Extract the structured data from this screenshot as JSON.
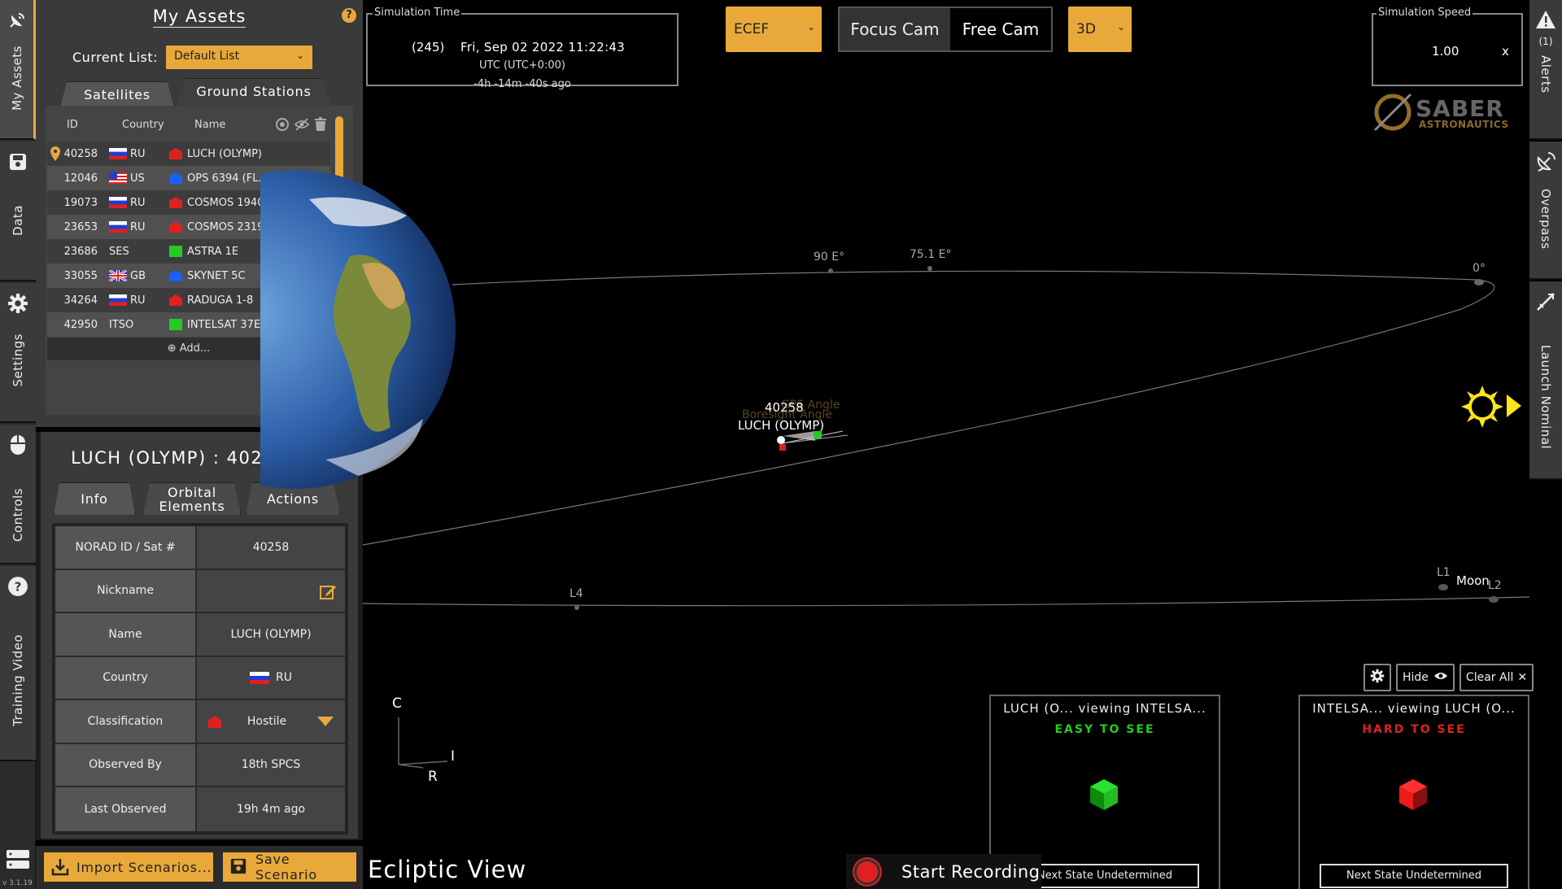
{
  "app": {
    "version": "v 3.1.19"
  },
  "left_rail": {
    "tabs": [
      {
        "label": "My Assets",
        "icon": "satellite-dish-icon"
      },
      {
        "label": "Data",
        "icon": "save-icon"
      },
      {
        "label": "Settings",
        "icon": "gear-icon"
      },
      {
        "label": "Controls",
        "icon": "mouse-icon"
      },
      {
        "label": "Training Video",
        "icon": "help-circle-icon"
      }
    ]
  },
  "assets": {
    "title": "My Assets",
    "current_list_label": "Current List:",
    "current_list_value": "Default List",
    "tabs": [
      "Satellites",
      "Ground Stations"
    ],
    "columns": [
      "ID",
      "Country",
      "Name"
    ],
    "rows": [
      {
        "id": "40258",
        "country": "RU",
        "name": "LUCH (OLYMP)",
        "class": "hostile",
        "flag": "ru"
      },
      {
        "id": "12046",
        "country": "US",
        "name": "OPS 6394 (FL...",
        "class": "friendly",
        "flag": "us"
      },
      {
        "id": "19073",
        "country": "RU",
        "name": "COSMOS 1940",
        "class": "hostile",
        "flag": "ru"
      },
      {
        "id": "23653",
        "country": "RU",
        "name": "COSMOS 2319",
        "class": "hostile",
        "flag": "ru"
      },
      {
        "id": "23686",
        "country": "SES",
        "name": "ASTRA 1E",
        "class": "neutral",
        "flag": ""
      },
      {
        "id": "33055",
        "country": "GB",
        "name": "SKYNET 5C",
        "class": "friendly",
        "flag": "gb"
      },
      {
        "id": "34264",
        "country": "RU",
        "name": "RADUGA 1-8",
        "class": "hostile",
        "flag": "ru"
      },
      {
        "id": "42950",
        "country": "ITSO",
        "name": "INTELSAT 37E",
        "class": "neutral",
        "flag": ""
      }
    ],
    "add_label": "Add..."
  },
  "detail": {
    "title": "LUCH (OLYMP) : 40258",
    "tabs": [
      "Info",
      "Orbital Elements",
      "Actions"
    ],
    "rows": [
      {
        "key": "NORAD ID / Sat #",
        "value": "40258"
      },
      {
        "key": "Nickname",
        "value": ""
      },
      {
        "key": "Name",
        "value": "LUCH (OLYMP)"
      },
      {
        "key": "Country",
        "value": "RU"
      },
      {
        "key": "Classification",
        "value": "Hostile"
      },
      {
        "key": "Observed By",
        "value": "18th SPCS"
      },
      {
        "key": "Last Observed",
        "value": "19h 4m ago"
      }
    ]
  },
  "bottom_buttons": {
    "import": "Import Scenarios...",
    "save": "Save Scenario"
  },
  "sim_time": {
    "label": "Simulation Time",
    "day": "(245)",
    "datetime": "Fri, Sep 02 2022 11:22:43",
    "timezone": "UTC (UTC+0:00)",
    "ago": "-4h -14m -40s ago"
  },
  "frame_select": "ECEF",
  "camera": {
    "focus": "Focus Cam",
    "free": "Free Cam"
  },
  "dimension_select": "3D",
  "sim_speed": {
    "label": "Simulation Speed",
    "value": "1.00",
    "suffix": "x"
  },
  "logo": {
    "line1": "SABER",
    "line2": "ASTRONAUTICS"
  },
  "scene": {
    "view_label": "Ecliptic View",
    "labels": {
      "e90": "90 E°",
      "e75": "75.1 E°",
      "zero": "0°",
      "l4": "L4",
      "l1": "L1",
      "l2": "L2",
      "moon": "Moon",
      "sat_id": "40258",
      "sat_name": "LUCH (OLYMP)",
      "ghost1": "Boresight Angle",
      "ghost2": "GPS Angle"
    },
    "axes": {
      "c": "C",
      "i": "I",
      "r": "R"
    }
  },
  "right_rail": {
    "alerts": {
      "count": "(1)",
      "label": "Alerts"
    },
    "overpass": "Overpass",
    "launch": "Launch Nominal"
  },
  "panel_tools": {
    "hide": "Hide",
    "clear": "Clear All"
  },
  "view_panels": [
    {
      "title": "LUCH (O... viewing INTELSA...",
      "status": "EASY TO SEE",
      "status_color": "#22cc22",
      "next": "Next State Undetermined"
    },
    {
      "title": "INTELSA... viewing LUCH (O...",
      "status": "HARD TO SEE",
      "status_color": "#e02020",
      "next": "Next State Undetermined"
    }
  ],
  "recording": {
    "label": "Start Recording"
  },
  "colors": {
    "accent": "#e8a93a",
    "hostile": "#e02020",
    "friendly": "#1a5fff",
    "neutral": "#22cc22"
  }
}
